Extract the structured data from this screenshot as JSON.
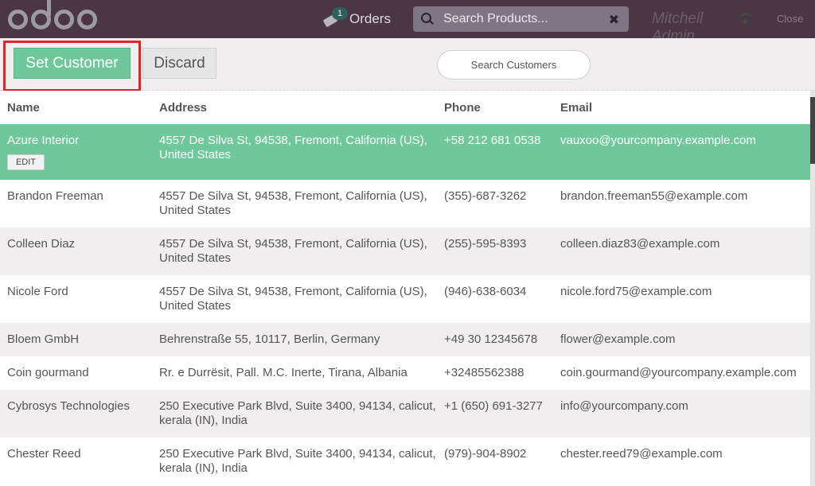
{
  "header": {
    "orders_label": "Orders",
    "orders_count": "1",
    "product_search_placeholder": "Search Products...",
    "clear_glyph": "✖",
    "user_name": "Mitchell Admin",
    "close_label": "Close"
  },
  "actions": {
    "set_customer_label": "Set Customer",
    "discard_label": "Discard",
    "customer_search_placeholder": "Search Customers"
  },
  "table": {
    "columns": [
      "Name",
      "Address",
      "Phone",
      "Email"
    ],
    "rows": [
      {
        "name": "Azure Interior",
        "address": "4557 De Silva St, 94538, Fremont, California (US), United States",
        "phone": "+58 212 681 0538",
        "email": "vauxoo@yourcompany.example.com",
        "edit_label": "EDIT"
      },
      {
        "name": "Brandon Freeman",
        "address": "4557 De Silva St, 94538, Fremont, California (US), United States",
        "phone": "(355)-687-3262",
        "email": "brandon.freeman55@example.com"
      },
      {
        "name": "Colleen Diaz",
        "address": "4557 De Silva St, 94538, Fremont, California (US), United States",
        "phone": "(255)-595-8393",
        "email": "colleen.diaz83@example.com"
      },
      {
        "name": "Nicole Ford",
        "address": "4557 De Silva St, 94538, Fremont, California (US), United States",
        "phone": "(946)-638-6034",
        "email": "nicole.ford75@example.com"
      },
      {
        "name": "Bloem GmbH",
        "address": "Behrenstraße 55, 10117, Berlin, Germany",
        "phone": "+49 30 12345678",
        "email": "flower@example.com"
      },
      {
        "name": "Coin gourmand",
        "address": "Rr. e Durrësit, Pall. M.C. Inerte, Tirana, Albania",
        "phone": "+32485562388",
        "email": "coin.gourmand@yourcompany.example.com"
      },
      {
        "name": "Cybrosys Technologies",
        "address": "250 Executive Park Blvd, Suite 3400, 94134, calicut, kerala (IN), India",
        "phone": "+1 (650) 691-3277",
        "email": "info@yourcompany.com"
      },
      {
        "name": "Chester Reed",
        "address": "250 Executive Park Blvd, Suite 3400, 94134, calicut, kerala (IN), India",
        "phone": "(979)-904-8902",
        "email": "chester.reed79@example.com"
      }
    ]
  },
  "colors": {
    "topbar": "#4b3644",
    "accent_green": "#6ec89b",
    "highlight_red": "#e0242c"
  }
}
